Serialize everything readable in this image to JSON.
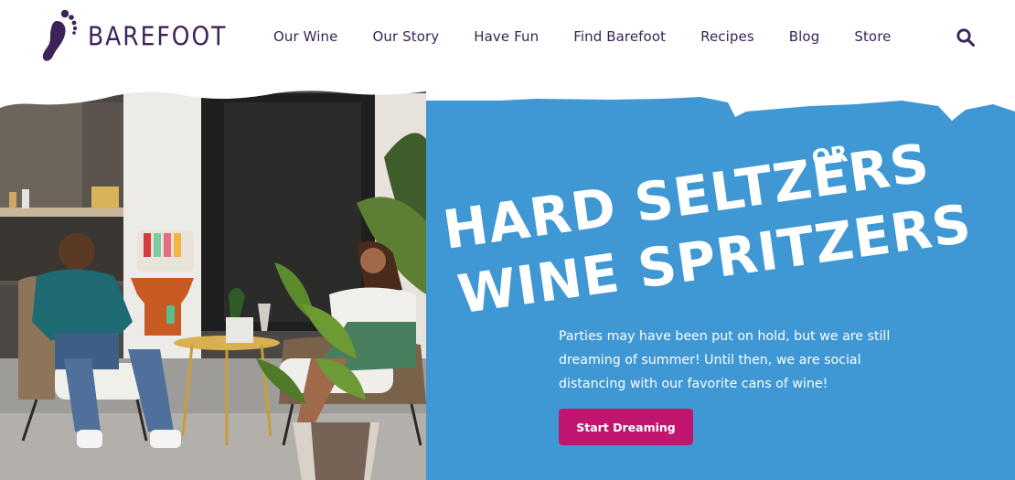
{
  "brand": {
    "name": "BAREFOOT",
    "logo_icon": "footprint-icon"
  },
  "nav": {
    "items": [
      "Our Wine",
      "Our Story",
      "Have Fun",
      "Find Barefoot",
      "Recipes",
      "Blog",
      "Store"
    ],
    "search_icon": "search-icon"
  },
  "hero": {
    "headline_line1": "HARD SELTZERS",
    "headline_or": "OR",
    "headline_line2": "WINE SPRITZERS",
    "body": "Parties may have been put on hold, but we are still dreaming of summer! Until then, we are social distancing with our favorite cans of wine!",
    "cta_label": "Start Dreaming"
  },
  "colors": {
    "brand_purple": "#3d2159",
    "panel_blue": "#3f98d3",
    "cta_magenta": "#c0166f"
  }
}
